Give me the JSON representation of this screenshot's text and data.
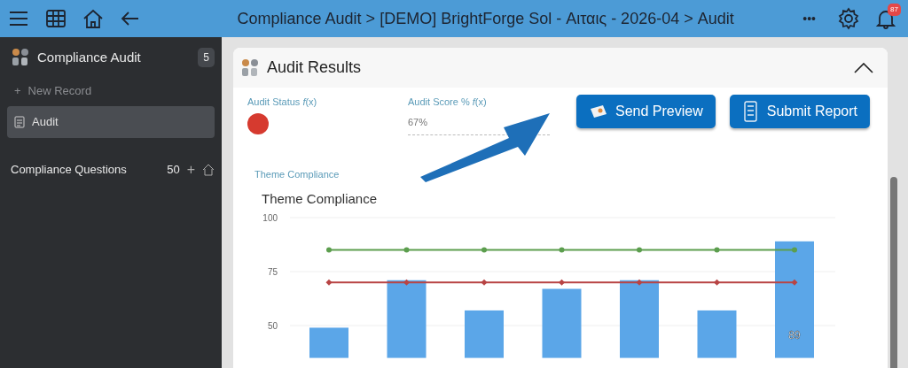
{
  "topbar": {
    "title": "Compliance Audit > [DEMO] BrightForge Sol - Αιταις - 2026-04 > Audit",
    "more": "•••",
    "notifications": "87"
  },
  "sidebar": {
    "title": "Compliance Audit",
    "count": "5",
    "new_record": "New Record",
    "new_icon": "+",
    "items": [
      {
        "label": "Audit",
        "selected": true
      }
    ],
    "sections": [
      {
        "label": "Compliance Questions",
        "count": "50",
        "add": "+"
      }
    ]
  },
  "card": {
    "title": "Audit Results",
    "expanded": true,
    "fields": [
      {
        "kind": "status",
        "label": "Audit Status *f*(x)",
        "color": "#d63a2f"
      },
      {
        "kind": "text",
        "label": "Audit Score % *f*(x)",
        "value": "67%"
      }
    ],
    "buttons": [
      {
        "kind": "send",
        "label": "Send Preview"
      },
      {
        "kind": "submit",
        "label": "Submit Report"
      }
    ],
    "chart_label": "Theme Compliance",
    "chart_data": {
      "type": "bar",
      "title": "Theme Compliance",
      "ylim": [
        35,
        100
      ],
      "yticks": [
        50,
        75,
        100
      ],
      "series": [
        {
          "type": "bar",
          "color": "#5ba6e8",
          "values": [
            49,
            71,
            57,
            67,
            71,
            57,
            89
          ]
        },
        {
          "type": "line",
          "color": "#5c9e4e",
          "marker": "circle",
          "values": [
            85,
            85,
            85,
            85,
            85,
            85,
            85
          ]
        },
        {
          "type": "line",
          "color": "#b84444",
          "marker": "diamond",
          "values": [
            70,
            70,
            70,
            70,
            70,
            70,
            70
          ]
        }
      ],
      "annotations": [
        "89"
      ]
    }
  }
}
